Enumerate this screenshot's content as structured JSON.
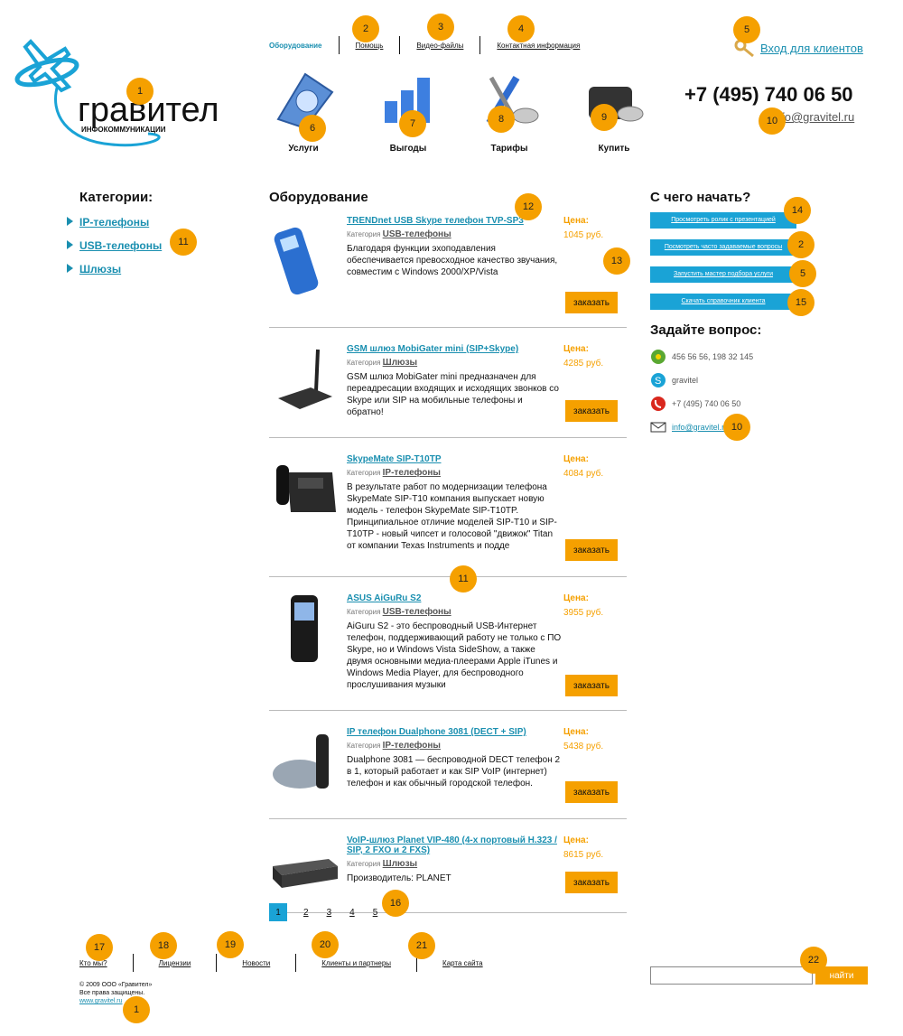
{
  "header": {
    "nav": [
      "Оборудование",
      "Помощь",
      "Видео-файлы",
      "Контактная информация"
    ],
    "login": "Вход для клиентов",
    "phone": "+7 (495) 740 06 50",
    "email": "info@gravitel.ru"
  },
  "logo": {
    "name": "гравител",
    "tagline": "ИНФОКОММУНИКАЦИИ"
  },
  "icons": [
    {
      "label": "Услуги"
    },
    {
      "label": "Выгоды"
    },
    {
      "label": "Тарифы"
    },
    {
      "label": "Купить"
    }
  ],
  "categories": {
    "title": "Категории:",
    "items": [
      "IP-телефоны",
      "USB-телефоны",
      "Шлюзы"
    ]
  },
  "main": {
    "title": "Оборудование",
    "category_prefix": "Категория",
    "price_label": "Цена:",
    "order_label": "заказать",
    "products": [
      {
        "name": "TRENDnet USB Skype телефон TVP-SP3",
        "category": "USB-телефоны",
        "desc": "Благодаря функции эхоподавления обеспечивается превосходное качество звучания, совместим с Windows 2000/XP/Vista",
        "price": "1045 руб."
      },
      {
        "name": "GSM шлюз MobiGater mini (SIP+Skype)",
        "category": "Шлюзы",
        "desc": "GSM шлюз MobiGater mini предназначен для переадресации входящих и исходящих звонков со Skype или SIP на мобильные телефоны и обратно!",
        "price": "4285 руб."
      },
      {
        "name": "SkypeMate SIP-T10TP",
        "category": "IP-телефоны",
        "desc": "В результате работ по модернизации телефона SkypeMate SIP-T10 компания выпускает новую модель - телефон SkypeMate SIP-T10TP. Принципиальное отличие моделей SIP-T10 и SIP-T10TP - новый чипсет и голосовой \"движок\" Titan от компании Texas Instruments и подде",
        "price": "4084 руб."
      },
      {
        "name": "ASUS AiGuRu S2",
        "category": "USB-телефоны",
        "desc": "AiGuru S2 - это беспроводный USB-Интернет телефон, поддерживающий работу не только с ПО Skype, но и Windows Vista SideShow, а также двумя основными медиа-плеерами Apple iTunes и Windows Media Player, для беспроводного прослушивания музыки",
        "price": "3955 руб."
      },
      {
        "name": "IP телефон Dualphone 3081 (DECT + SIP)",
        "category": "IP-телефоны",
        "desc": "Dualphone 3081 — беспроводной DECT телефон 2 в 1, который работает и как SIP VoIP (интернет) телефон и как обычный городской телефон.",
        "price": "5438 руб."
      },
      {
        "name": "VoIP-шлюз Planet VIP-480 (4-х портовый H.323 / SIP, 2 FXO и 2 FXS)",
        "category": "Шлюзы",
        "desc": "Производитель: PLANET",
        "price": "8615 руб."
      }
    ],
    "pages": [
      "1",
      "2",
      "3",
      "4",
      "5"
    ]
  },
  "right": {
    "start_title": "С чего начать?",
    "start_buttons": [
      "Просмотреть ролик с презентацией",
      "Посмотреть часто задаваемые вопросы",
      "Запустить мастер подбора услуги",
      "Скачать справочник клиента"
    ],
    "ask_title": "Задайте вопрос:",
    "contacts": {
      "icq": "456 56 56, 198 32 145",
      "skype": "gravitel",
      "phone": "+7 (495) 740 06 50",
      "email": "info@gravitel.ru"
    }
  },
  "footer": {
    "nav": [
      "Кто мы?",
      "Лицензии",
      "Новости",
      "Клиенты и партнеры",
      "Карта сайта"
    ],
    "copyright": "© 2009 ООО «Гравител»",
    "rights": "Все права защищены.",
    "site": "www.gravitel.ru",
    "search_button": "найти"
  },
  "markers": [
    "1",
    "2",
    "3",
    "4",
    "5",
    "6",
    "7",
    "8",
    "9",
    "10",
    "12",
    "13",
    "11",
    "11",
    "14",
    "2",
    "5",
    "15",
    "10",
    "16",
    "17",
    "18",
    "19",
    "20",
    "21",
    "22",
    "1"
  ],
  "colors": {
    "accent": "#f5a000",
    "link": "#1a8fb0",
    "blue_button": "#1aa3d6"
  }
}
